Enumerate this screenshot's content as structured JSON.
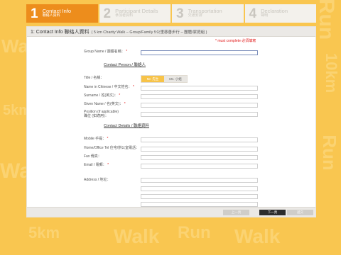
{
  "background": {
    "words": [
      "Walk",
      "Run",
      "10km",
      "5km",
      "Walk",
      "Run",
      "Walk",
      "5km",
      "Walk",
      "Run"
    ]
  },
  "steps": [
    {
      "number": "1",
      "title": "Contact Info",
      "subtitle": "聯絡人資料",
      "active": true
    },
    {
      "number": "2",
      "title": "Participant Details",
      "subtitle": "參加者資料",
      "active": false
    },
    {
      "number": "3",
      "title": "Transportation",
      "subtitle": "交通安排",
      "active": false
    },
    {
      "number": "4",
      "title": "Declaration",
      "subtitle": "聲明",
      "active": false
    }
  ],
  "panel": {
    "header_main": "1: Contact Info 聯絡人資料",
    "header_sub": "( 5 km Charity Walk – Group/Family 5公里慈善步行 – 團體/家庭組 )",
    "required_note": "* must complete 必須填寫"
  },
  "form": {
    "group_name_label": "Group Name / 團體名稱：",
    "contact_person_title": "Contact Person / 聯絡人",
    "title_label": "Title / 名稱：",
    "title_options": [
      "Mr. 先生",
      "Ms. 小姐"
    ],
    "name_chinese_label": "Name in Chinese / 中文姓名：",
    "surname_label": "Surname / 姓(英文)：",
    "given_name_label": "Given Name / 名(英文)：",
    "position_label_1": "Position (if applicable)",
    "position_label_2": "職位 (如適用)：",
    "contact_details_title": "Contact Details / 聯絡資料",
    "mobile_label": "Mobile 手提：",
    "home_office_label": "Home/Office Tel 住宅/辦公室電話：",
    "fax_label": "Fax 傳真：",
    "email_label": "Email / 電郵：",
    "address_label": "Address / 地址："
  },
  "footer": {
    "prev_label": "上一頁",
    "next_label": "下一頁",
    "submit_label": "遞交"
  },
  "colors": {
    "background": "#f9c650",
    "active_step": "#ed8d1c",
    "required": "#e21a1a",
    "toggle_selected": "#f7c348"
  }
}
